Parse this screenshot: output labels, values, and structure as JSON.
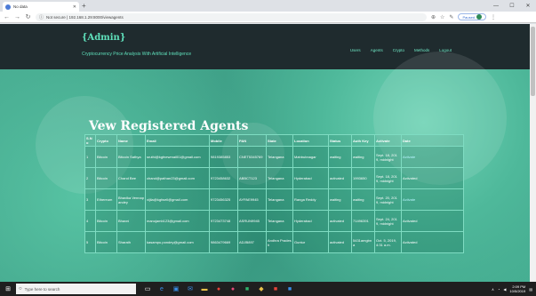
{
  "browser": {
    "tab_title": "No data",
    "address": "Not secure | 192.168.1.29:8000/viewagents",
    "paused_label": "Paused"
  },
  "header": {
    "brand": "{Admin}",
    "subtitle": "Cryptocurrency Price Analysis With Artificial Intelligence",
    "menu": [
      "Users",
      "Agents",
      "Crypto",
      "Methods",
      "Logout"
    ]
  },
  "page_heading": "Vew Registered Agents",
  "table": {
    "columns": [
      "S.No",
      "Crypto",
      "Name",
      "Email",
      "Mobile",
      "PAN",
      "State",
      "Location",
      "Status",
      "Auth Key",
      "Activate",
      "Date"
    ],
    "rows": [
      [
        "1",
        "Bitcoin",
        "Bitcoin Sathya",
        "sruthi@kgfnewmail01@gmail.com",
        "9819385853",
        "CNET5345769",
        "Telangana",
        "Mahbubnagar",
        "waiting",
        "waiting",
        "Sept. 18, 2019, midnight",
        "Activate"
      ],
      [
        "2",
        "Bitcoin",
        "Chand Bee",
        "chand@pathan23@gmail.com",
        "9723458632",
        "ABBCT123",
        "Telangana",
        "Hyderabad",
        "activated",
        "1993650",
        "Sept. 18, 2019, midnight",
        "Activated"
      ],
      [
        "3",
        "Ethereum",
        "Bhavika Vennapandey",
        "vijila@kgfwell@gmail.com",
        "9723456325",
        "AYPAE9945",
        "Telangana",
        "Ranga Reddy",
        "waiting",
        "waiting",
        "Sept. 20, 2019, midnight",
        "Activate"
      ],
      [
        "4",
        "Bitcoin",
        "Bhavni",
        "manojamb123@gmail.com",
        "9723473748",
        "ASRUN9945",
        "Telangana",
        "Hyderabad",
        "activated",
        "71496391",
        "Sept. 24, 2019, midnight",
        "Activated"
      ],
      [
        "5",
        "Bitcoin",
        "Sharath",
        "kasampu.pondey@gmail.com",
        "9863479669",
        "ADJB897",
        "Andhra Pradesh",
        "Guntur",
        "activated",
        "5431amgbna",
        "Oct. 5, 2019, 4:31 a.m.",
        "Activated"
      ]
    ]
  },
  "taskbar": {
    "search_placeholder": "Type here to search",
    "time": "2:09 PM",
    "date": "10/5/2019"
  }
}
